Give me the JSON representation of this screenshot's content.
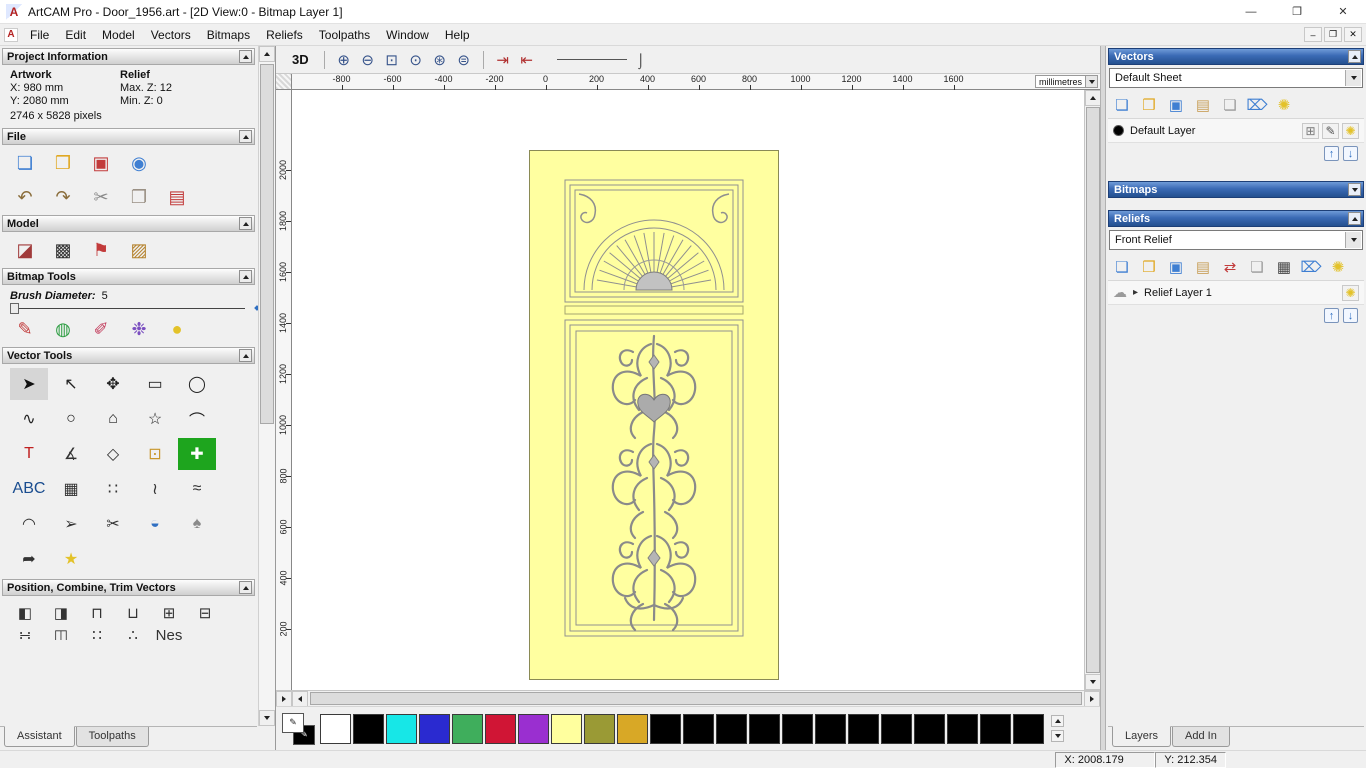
{
  "colors": {
    "header_blue": "#2f5fae",
    "door_yellow": "#ffffa0",
    "canvas_bg": "#ffffff",
    "selection_green": "#1ea51e"
  },
  "titlebar": {
    "app_icon": "A",
    "title": "ArtCAM Pro - Door_1956.art - [2D View:0 - Bitmap Layer 1]",
    "minimize": "—",
    "maximize": "❐",
    "close": "✕"
  },
  "menubar": {
    "doc_icon": "A",
    "items": [
      {
        "name": "menu-file",
        "label": "File"
      },
      {
        "name": "menu-edit",
        "label": "Edit"
      },
      {
        "name": "menu-model",
        "label": "Model"
      },
      {
        "name": "menu-vectors",
        "label": "Vectors"
      },
      {
        "name": "menu-bitmaps",
        "label": "Bitmaps"
      },
      {
        "name": "menu-reliefs",
        "label": "Reliefs"
      },
      {
        "name": "menu-toolpaths",
        "label": "Toolpaths"
      },
      {
        "name": "menu-window",
        "label": "Window"
      },
      {
        "name": "menu-help",
        "label": "Help"
      }
    ],
    "mdi_minimize": "–",
    "mdi_restore": "❐",
    "mdi_close": "✕"
  },
  "left_panel": {
    "project": {
      "title": "Project Information",
      "artwork": "Artwork",
      "relief": "Relief",
      "x": "X: 980 mm",
      "y": "Y: 2080 mm",
      "maxz": "Max. Z: 12",
      "minz": "Min. Z: 0",
      "pixels": "2746 x 5828 pixels"
    },
    "file": {
      "title": "File",
      "row1": [
        {
          "name": "new-model-icon",
          "glyph": "❏",
          "fg": "#3f7fd2"
        },
        {
          "name": "open-model-icon",
          "glyph": "❒",
          "fg": "#e0a823"
        },
        {
          "name": "save-model-icon",
          "glyph": "▣",
          "fg": "#c23b3b"
        },
        {
          "name": "import-export-icon",
          "glyph": "◉",
          "fg": "#3f7fd2"
        }
      ],
      "row2": [
        {
          "name": "undo-icon",
          "glyph": "↶",
          "fg": "#8a6d3b"
        },
        {
          "name": "redo-icon",
          "glyph": "↷",
          "fg": "#8a6d3b"
        },
        {
          "name": "cut-icon",
          "glyph": "✂",
          "fg": "#8a8a8a"
        },
        {
          "name": "paste-icon",
          "glyph": "❐",
          "fg": "#9a9084"
        },
        {
          "name": "notes-icon",
          "glyph": "▤",
          "fg": "#c23b3b"
        }
      ]
    },
    "model": {
      "title": "Model",
      "row": [
        {
          "name": "greyscale-model-icon",
          "glyph": "◪",
          "fg": "#a03a3a"
        },
        {
          "name": "model-preview-icon",
          "glyph": "▩",
          "fg": "#333333"
        },
        {
          "name": "lighthouse-icon",
          "glyph": "⚑",
          "fg": "#c23b3b"
        },
        {
          "name": "load-image-icon",
          "glyph": "▨",
          "fg": "#b5832f"
        }
      ]
    },
    "bitmap": {
      "title": "Bitmap Tools",
      "brush_label": "Brush Diameter:",
      "brush_value": "5",
      "row": [
        {
          "name": "paint-icon",
          "glyph": "✎",
          "fg": "#c23b3b"
        },
        {
          "name": "paint-selected-colour-icon",
          "glyph": "◍",
          "fg": "#2f9e44"
        },
        {
          "name": "draw-colour-icon",
          "glyph": "✐",
          "fg": "#c23b5b"
        },
        {
          "name": "colour-palette-icon",
          "glyph": "❉",
          "fg": "#7b4fc0"
        },
        {
          "name": "flood-fill-icon",
          "glyph": "●",
          "fg": "#e3c229"
        }
      ]
    },
    "vector": {
      "title": "Vector Tools",
      "tools": [
        {
          "name": "select-vectors-tool",
          "glyph": "➤",
          "fg": "#111111",
          "bg": "#d6d6d6"
        },
        {
          "name": "node-editing-tool",
          "glyph": "↖",
          "fg": "#222222"
        },
        {
          "name": "transform-vectors-tool",
          "glyph": "✥",
          "fg": "#222222"
        },
        {
          "name": "create-rectangle-tool",
          "glyph": "▭",
          "fg": "#222222"
        },
        {
          "name": "create-ellipse-tool",
          "glyph": "◯",
          "fg": "#222222"
        },
        {
          "name": "create-freeform-tool",
          "glyph": "∿",
          "fg": "#222222"
        },
        {
          "name": "create-circle-tool",
          "glyph": "○",
          "fg": "#222222"
        },
        {
          "name": "create-polygon-tool",
          "glyph": "⌂",
          "fg": "#222222"
        },
        {
          "name": "create-star-tool",
          "glyph": "☆",
          "fg": "#222222"
        },
        {
          "name": "create-arc-tool",
          "glyph": "⌒",
          "fg": "#222222"
        },
        {
          "name": "create-text-tool",
          "glyph": "T",
          "fg": "#c02020"
        },
        {
          "name": "measure-tool",
          "glyph": "∡",
          "fg": "#333333"
        },
        {
          "name": "create-diamond-tool",
          "glyph": "◇",
          "fg": "#333333"
        },
        {
          "name": "offset-vector-tool",
          "glyph": "⊡",
          "fg": "#c8962a"
        },
        {
          "name": "block-paste-tool",
          "glyph": "✚",
          "fg": "#ffffff",
          "bg": "#1ea51e"
        },
        {
          "name": "text-block-tool",
          "glyph": "ABC",
          "fg": "#1a4d8f"
        },
        {
          "name": "grid-tool",
          "glyph": "▦",
          "fg": "#333333"
        },
        {
          "name": "paste-array-tool",
          "glyph": "∷",
          "fg": "#333333"
        },
        {
          "name": "fit-curve-tool",
          "glyph": "≀",
          "fg": "#333333"
        },
        {
          "name": "smooth-curve-tool",
          "glyph": "≈",
          "fg": "#333333"
        },
        {
          "name": "arc-through-points-tool",
          "glyph": "◠",
          "fg": "#333333"
        },
        {
          "name": "polyline-tool",
          "glyph": "➢",
          "fg": "#333333"
        },
        {
          "name": "trim-vectors-tool",
          "glyph": "✂",
          "fg": "#333333"
        },
        {
          "name": "extrude-tool",
          "glyph": "◒",
          "fg": "#2f6fc2"
        },
        {
          "name": "nesting-tool",
          "glyph": "♠",
          "fg": "#8a8a8a"
        },
        {
          "name": "fillet-tool",
          "glyph": "➦",
          "fg": "#333333"
        },
        {
          "name": "wrap-star-tool",
          "glyph": "★",
          "fg": "#e3c229"
        }
      ]
    },
    "position": {
      "title": "Position, Combine, Trim Vectors",
      "row1": [
        {
          "name": "align-left-icon",
          "glyph": "◧"
        },
        {
          "name": "align-right-icon",
          "glyph": "◨"
        },
        {
          "name": "align-top-icon",
          "glyph": "⊓"
        },
        {
          "name": "align-bottom-icon",
          "glyph": "⊔"
        },
        {
          "name": "center-in-page-icon",
          "glyph": "⊞"
        },
        {
          "name": "center-line-icon",
          "glyph": "⊟"
        }
      ],
      "row2": [
        {
          "name": "distribute-icon",
          "glyph": "∺"
        },
        {
          "name": "mirror-icon",
          "glyph": "◫"
        },
        {
          "name": "block-copy-icon",
          "glyph": "∷"
        },
        {
          "name": "rotate-copy-icon",
          "glyph": "∴"
        },
        {
          "name": "nest-tool-label",
          "glyph": "Nes"
        }
      ]
    },
    "tabs": [
      {
        "name": "tab-assistant",
        "label": "Assistant",
        "active": true
      },
      {
        "name": "tab-toolpaths",
        "label": "Toolpaths"
      }
    ]
  },
  "canvas": {
    "toolbar": {
      "view3d": "3D",
      "zoom": [
        {
          "name": "zoom-in-icon",
          "glyph": "⊕"
        },
        {
          "name": "zoom-out-icon",
          "glyph": "⊖"
        },
        {
          "name": "zoom-window-icon",
          "glyph": "⊡"
        },
        {
          "name": "zoom-100-icon",
          "glyph": "⊙"
        },
        {
          "name": "zoom-fit-icon",
          "glyph": "⊛"
        },
        {
          "name": "zoom-previous-icon",
          "glyph": "⊜"
        }
      ],
      "nav": [
        {
          "name": "snap-grid-icon",
          "glyph": "⇥"
        },
        {
          "name": "snap-guides-icon",
          "glyph": "⇤"
        }
      ],
      "sim_glyph": "⌡"
    },
    "ruler_h": [
      "-800",
      "-600",
      "-400",
      "-200",
      "0",
      "200",
      "400",
      "600",
      "800",
      "1000",
      "1200",
      "1400",
      "1600"
    ],
    "ruler_v": [
      "2000",
      "1800",
      "1600",
      "1400",
      "1200",
      "1000",
      "800",
      "600",
      "400",
      "200"
    ],
    "units": "millimetres"
  },
  "right_panel": {
    "vectors": {
      "title": "Vectors",
      "sheet": "Default Sheet",
      "icons": [
        {
          "name": "new-vector-layer-icon",
          "glyph": "❏",
          "fg": "#3f7fd2"
        },
        {
          "name": "open-vectors-icon",
          "glyph": "❒",
          "fg": "#e0a823"
        },
        {
          "name": "save-vectors-icon",
          "glyph": "▣",
          "fg": "#3f7fd2"
        },
        {
          "name": "merge-vector-layers-icon",
          "glyph": "▤",
          "fg": "#c9a25e"
        },
        {
          "name": "new-sheet-icon",
          "glyph": "❏",
          "fg": "#9a9a9a"
        },
        {
          "name": "delete-vector-layer-icon",
          "glyph": "⌦",
          "fg": "#3f7fd2"
        },
        {
          "name": "toggle-all-vectors-icon",
          "glyph": "✺",
          "fg": "#e3c229"
        }
      ],
      "layer": {
        "label": "Default Layer",
        "swatch": "#000000",
        "icons": [
          {
            "name": "snap-layer-icon",
            "glyph": "⊞",
            "fg": "#777777"
          },
          {
            "name": "edit-layer-icon",
            "glyph": "✎",
            "fg": "#555555"
          },
          {
            "name": "layer-visibility-icon",
            "glyph": "✺",
            "fg": "#e3c229"
          }
        ]
      },
      "up": "↑",
      "down": "↓"
    },
    "bitmaps": {
      "title": "Bitmaps"
    },
    "reliefs": {
      "title": "Reliefs",
      "relief": "Front Relief",
      "icons": [
        {
          "name": "new-relief-icon",
          "glyph": "❏",
          "fg": "#3f7fd2"
        },
        {
          "name": "open-relief-icon",
          "glyph": "❒",
          "fg": "#e0a823"
        },
        {
          "name": "save-relief-icon",
          "glyph": "▣",
          "fg": "#3f7fd2"
        },
        {
          "name": "merge-relief-layers-icon",
          "glyph": "▤",
          "fg": "#c9a25e"
        },
        {
          "name": "transfer-relief-icon",
          "glyph": "⇄",
          "fg": "#c23b3b"
        },
        {
          "name": "blank-relief-icon",
          "glyph": "❏",
          "fg": "#9a9a9a"
        },
        {
          "name": "calculate-relief-icon",
          "glyph": "▦",
          "fg": "#444444"
        },
        {
          "name": "delete-relief-layer-icon",
          "glyph": "⌦",
          "fg": "#3f7fd2"
        },
        {
          "name": "toggle-all-reliefs-icon",
          "glyph": "✺",
          "fg": "#e3c229"
        }
      ],
      "layer": {
        "thumb": "☁",
        "expander": "▸",
        "label": "Relief Layer 1",
        "bulb": "✺"
      },
      "up": "↑",
      "down": "↓"
    },
    "tabs": [
      {
        "name": "tab-layers",
        "label": "Layers",
        "active": true
      },
      {
        "name": "tab-add-in",
        "label": "Add In"
      }
    ]
  },
  "palette": {
    "pen_glyph": "✎",
    "swatches": [
      "#ffffff",
      "#000000",
      "#17e7e7",
      "#2a2ad0",
      "#3fae5c",
      "#d01535",
      "#9a2fd0",
      "#ffff9e",
      "#9a9a35",
      "#d8a826",
      "#000000",
      "#000000",
      "#000000",
      "#000000",
      "#000000",
      "#000000",
      "#000000",
      "#000000",
      "#000000",
      "#000000",
      "#000000",
      "#000000"
    ]
  },
  "statusbar": {
    "x": "X: 2008.179",
    "y": "Y: 212.354"
  }
}
